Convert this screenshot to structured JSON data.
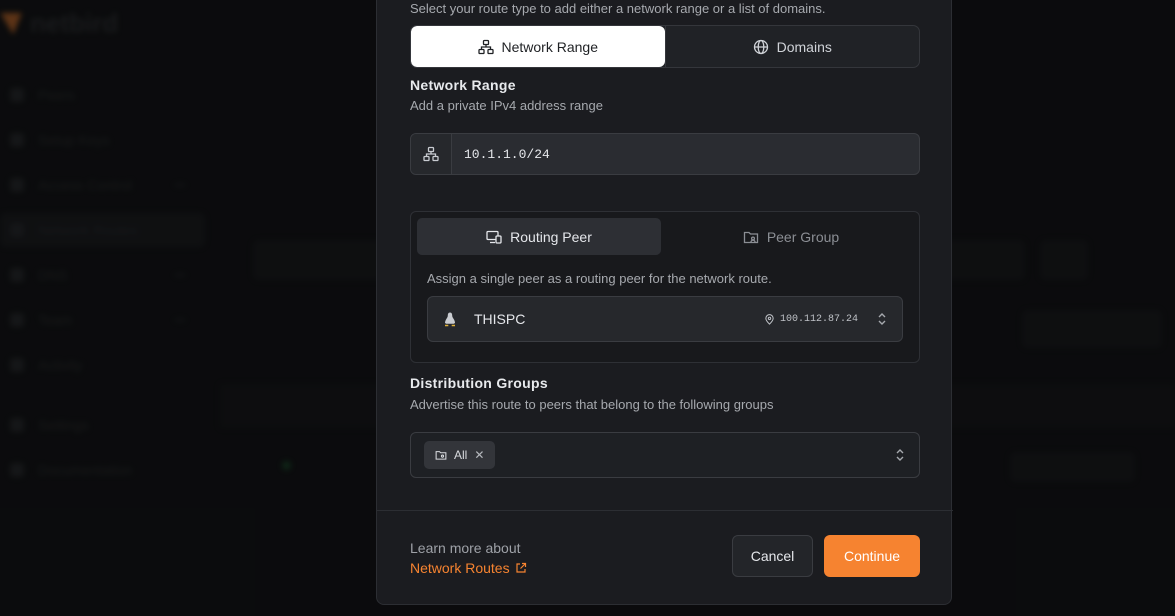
{
  "background": {
    "logo_text": "netbird",
    "sidebar": [
      "Peers",
      "Setup Keys",
      "Access Control",
      "Network Routes",
      "DNS",
      "Team",
      "Activity",
      "Settings",
      "Documentation"
    ]
  },
  "modal": {
    "route_type_hint": "Select your route type to add either a network range or a list of domains.",
    "route_type_tabs": [
      {
        "label": "Network Range",
        "icon": "network-icon",
        "active": true
      },
      {
        "label": "Domains",
        "icon": "globe-icon",
        "active": false
      }
    ],
    "network_range": {
      "title": "Network Range",
      "subtitle": "Add a private IPv4 address range",
      "value": "10.1.1.0/24"
    },
    "peer_tabs": [
      {
        "label": "Routing Peer",
        "icon": "routing-peer-icon",
        "active": true
      },
      {
        "label": "Peer Group",
        "icon": "folder-icon",
        "active": false
      }
    ],
    "peer_hint": "Assign a single peer as a routing peer for the network route.",
    "selected_peer": {
      "name": "THISPC",
      "ip": "100.112.87.24",
      "os_icon": "linux-icon"
    },
    "distribution": {
      "title": "Distribution Groups",
      "subtitle": "Advertise this route to peers that belong to the following groups",
      "chips": [
        "All"
      ]
    },
    "footer": {
      "learn_text": "Learn more about",
      "learn_link": "Network Routes",
      "cancel_label": "Cancel",
      "continue_label": "Continue"
    }
  },
  "colors": {
    "accent": "#f68330",
    "modal_bg": "#1b1c20"
  }
}
